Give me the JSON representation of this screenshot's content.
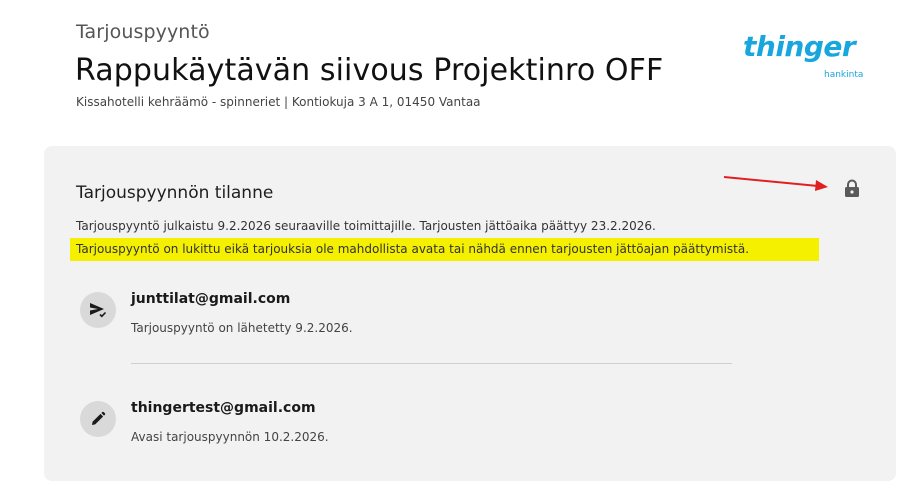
{
  "header": {
    "subtitle": "Tarjouspyyntö",
    "title": "Rappukäytävän siivous Projektinro OFF",
    "address": "Kissahotelli kehräämö - spinneriet | Kontiokuja 3 A 1, 01450 Vantaa"
  },
  "logo": {
    "word": "thinger",
    "sub": "hankinta",
    "color": "#17a6de"
  },
  "status": {
    "title": "Tarjouspyynnön tilanne",
    "published": "Tarjouspyyntö julkaistu 9.2.2026 seuraaville toimittajille. Tarjousten jättöaika päättyy 23.2.2026.",
    "locked_notice": "Tarjouspyyntö on lukittu eikä tarjouksia ole mahdollista avata tai nähdä ennen tarjousten jättöajan päättymistä.",
    "highlight_color": "#f4f000",
    "lock_icon": "lock-icon"
  },
  "entries": [
    {
      "icon": "send-icon",
      "email": "junttilat@gmail.com",
      "status": "Tarjouspyyntö on lähetetty 9.2.2026."
    },
    {
      "icon": "pencil-icon",
      "email": "thingertest@gmail.com",
      "status": "Avasi tarjouspyynnön 10.2.2026."
    }
  ]
}
